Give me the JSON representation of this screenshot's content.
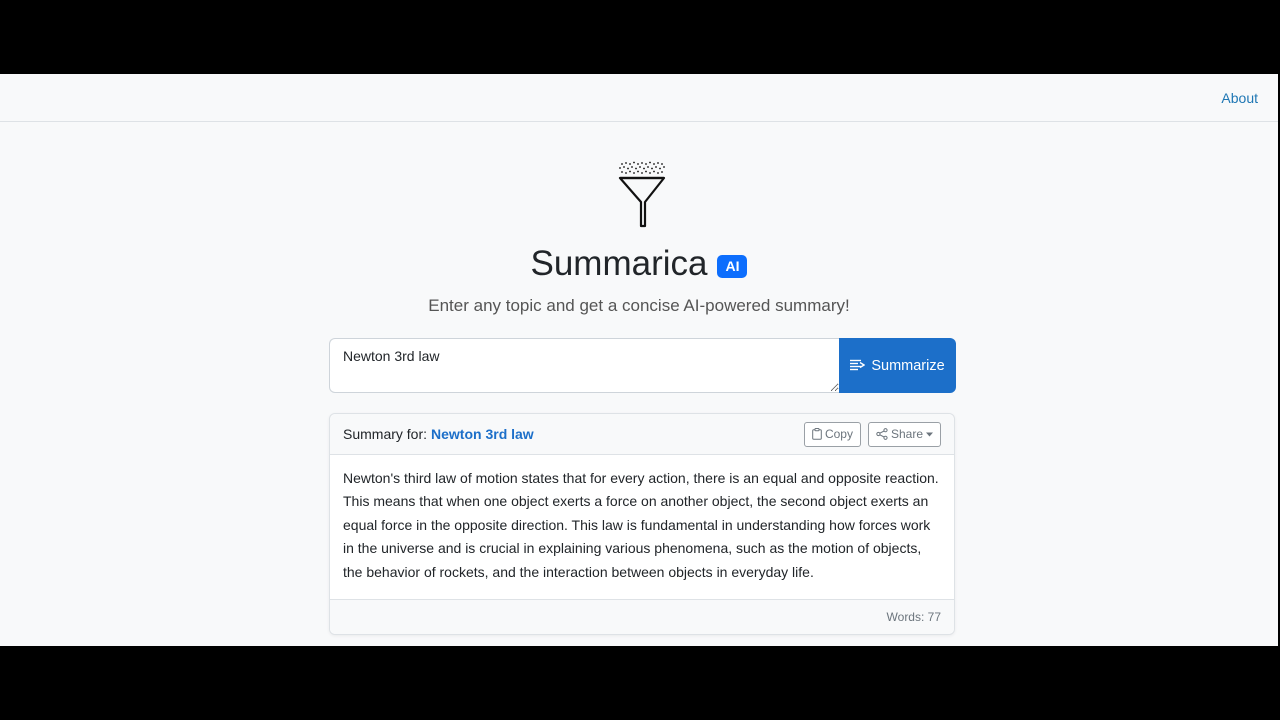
{
  "nav": {
    "about_label": "About"
  },
  "hero": {
    "logo_icon": "funnel-filter-icon",
    "title": "Summarica",
    "badge": "AI",
    "subtitle": "Enter any topic and get a concise AI-powered summary!"
  },
  "search": {
    "value": "Newton 3rd law",
    "button_label": "Summarize",
    "button_icon": "summarize-lines-icon"
  },
  "result": {
    "label": "Summary for:",
    "topic": "Newton 3rd law",
    "copy_label": "Copy",
    "copy_icon": "clipboard-icon",
    "share_label": "Share",
    "share_icon": "share-icon",
    "body": "Newton's third law of motion states that for every action, there is an equal and opposite reaction. This means that when one object exerts a force on another object, the second object exerts an equal force in the opposite direction. This law is fundamental in understanding how forces work in the universe and is crucial in explaining various phenomena, such as the motion of objects, the behavior of rockets, and the interaction between objects in everyday life.",
    "word_count": "Words: 77"
  },
  "colors": {
    "accent": "#1c6fc9",
    "badge": "#0d6efd",
    "link": "#1f77b4",
    "page_bg": "#f8f9fa"
  }
}
